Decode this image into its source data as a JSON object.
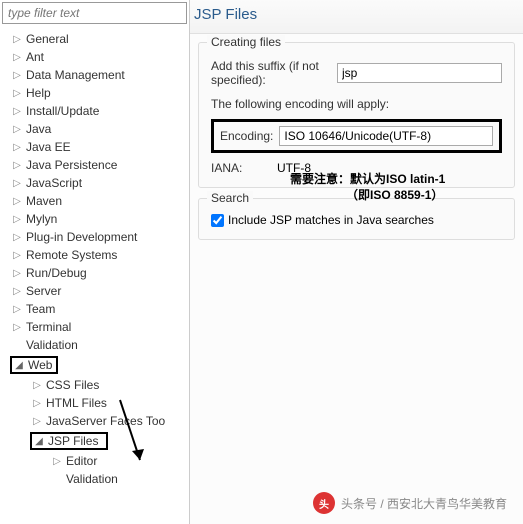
{
  "filter": {
    "placeholder": "type filter text"
  },
  "tree": {
    "items": [
      {
        "label": "General",
        "level": 0,
        "expanded": false,
        "hasChildren": true
      },
      {
        "label": "Ant",
        "level": 0,
        "expanded": false,
        "hasChildren": true
      },
      {
        "label": "Data Management",
        "level": 0,
        "expanded": false,
        "hasChildren": true
      },
      {
        "label": "Help",
        "level": 0,
        "expanded": false,
        "hasChildren": true
      },
      {
        "label": "Install/Update",
        "level": 0,
        "expanded": false,
        "hasChildren": true
      },
      {
        "label": "Java",
        "level": 0,
        "expanded": false,
        "hasChildren": true
      },
      {
        "label": "Java EE",
        "level": 0,
        "expanded": false,
        "hasChildren": true
      },
      {
        "label": "Java Persistence",
        "level": 0,
        "expanded": false,
        "hasChildren": true
      },
      {
        "label": "JavaScript",
        "level": 0,
        "expanded": false,
        "hasChildren": true
      },
      {
        "label": "Maven",
        "level": 0,
        "expanded": false,
        "hasChildren": true
      },
      {
        "label": "Mylyn",
        "level": 0,
        "expanded": false,
        "hasChildren": true
      },
      {
        "label": "Plug-in Development",
        "level": 0,
        "expanded": false,
        "hasChildren": true
      },
      {
        "label": "Remote Systems",
        "level": 0,
        "expanded": false,
        "hasChildren": true
      },
      {
        "label": "Run/Debug",
        "level": 0,
        "expanded": false,
        "hasChildren": true
      },
      {
        "label": "Server",
        "level": 0,
        "expanded": false,
        "hasChildren": true
      },
      {
        "label": "Team",
        "level": 0,
        "expanded": false,
        "hasChildren": true
      },
      {
        "label": "Terminal",
        "level": 0,
        "expanded": false,
        "hasChildren": true
      },
      {
        "label": "Validation",
        "level": 0,
        "expanded": false,
        "hasChildren": false
      },
      {
        "label": "Web",
        "level": 0,
        "expanded": true,
        "hasChildren": true,
        "boxed": "web"
      },
      {
        "label": "CSS Files",
        "level": 1,
        "expanded": false,
        "hasChildren": true
      },
      {
        "label": "HTML Files",
        "level": 1,
        "expanded": false,
        "hasChildren": true
      },
      {
        "label": "JavaServer Faces Too",
        "level": 1,
        "expanded": false,
        "hasChildren": true
      },
      {
        "label": "JSP Files",
        "level": 1,
        "expanded": true,
        "hasChildren": true,
        "boxed": "jsp"
      },
      {
        "label": "Editor",
        "level": 2,
        "expanded": false,
        "hasChildren": true
      },
      {
        "label": "Validation",
        "level": 2,
        "expanded": false,
        "hasChildren": false
      }
    ]
  },
  "header": {
    "title": "JSP Files"
  },
  "creating": {
    "legend": "Creating files",
    "suffix_label": "Add this suffix (if not specified):",
    "suffix_value": "jsp",
    "encoding_note": "The following encoding will apply:",
    "encoding_label": "Encoding:",
    "encoding_value": "ISO 10646/Unicode(UTF-8)",
    "iana_label": "IANA:",
    "iana_value": "UTF-8"
  },
  "search": {
    "legend": "Search",
    "checkbox_label": "Include JSP matches in Java searches",
    "checked": true
  },
  "annotation": {
    "line1": "需要注意：默认为ISO latin-1",
    "line2": "（即ISO 8859-1）"
  },
  "watermark": {
    "text": "头条号 / 西安北大青鸟华美教育"
  }
}
